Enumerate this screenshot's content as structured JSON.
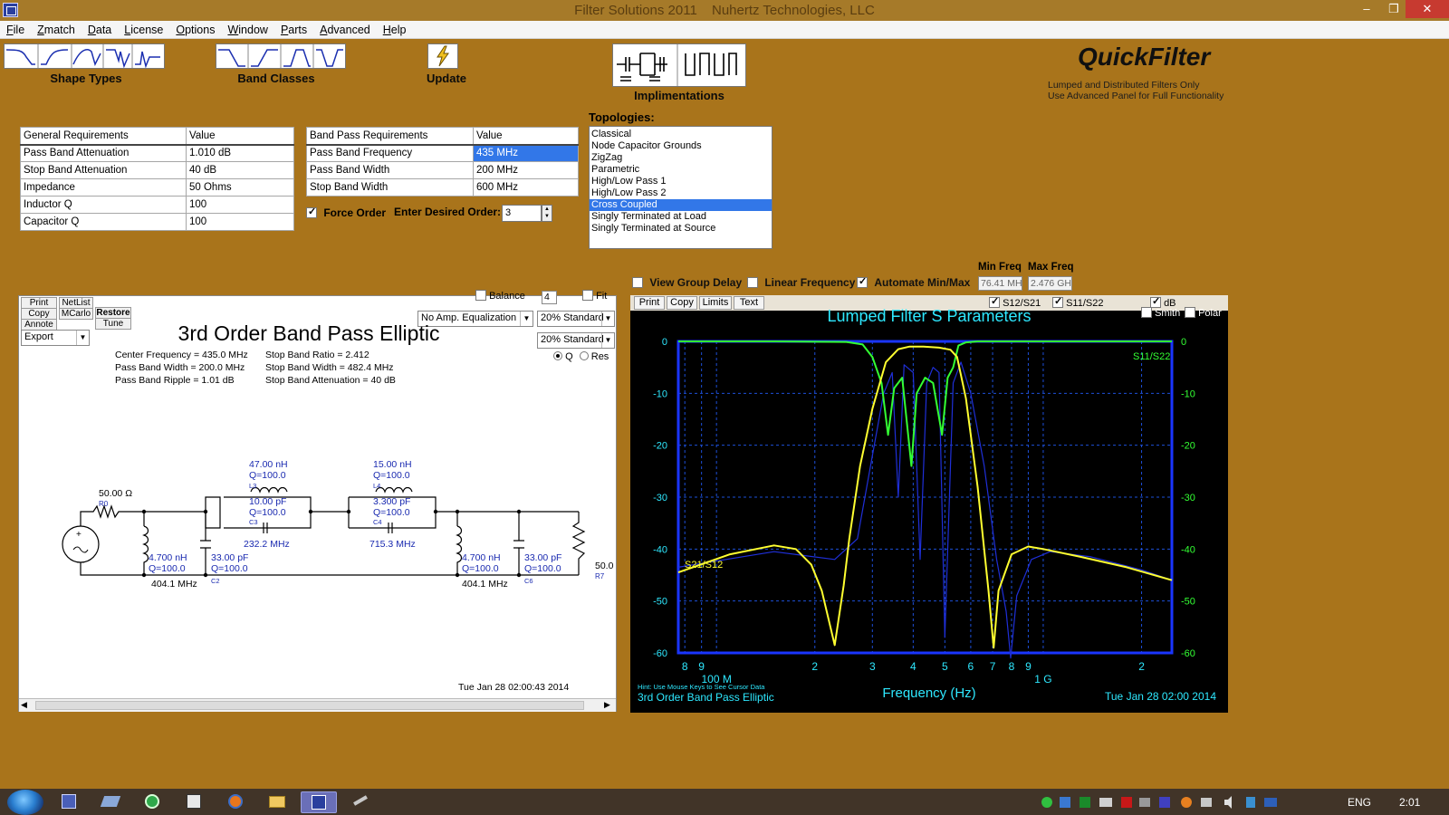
{
  "window": {
    "title_app": "Filter Solutions 2011",
    "title_company": "Nuhertz Technologies, LLC",
    "controls": {
      "minimize": "–",
      "restore": "❐",
      "close": "✕"
    }
  },
  "menu": [
    {
      "key": "F",
      "rest": "ile"
    },
    {
      "key": "Z",
      "rest": "match"
    },
    {
      "key": "D",
      "rest": "ata"
    },
    {
      "key": "L",
      "rest": "icense"
    },
    {
      "key": "O",
      "rest": "ptions"
    },
    {
      "key": "W",
      "rest": "indow"
    },
    {
      "key": "P",
      "rest": "arts"
    },
    {
      "key": "A",
      "rest": "dvanced"
    },
    {
      "key": "H",
      "rest": "elp"
    }
  ],
  "toolbar": {
    "shape_types": "Shape Types",
    "band_classes": "Band Classes",
    "update": "Update",
    "implementations": "Implimentations",
    "update_icon": "lightning-icon"
  },
  "quickfilter": {
    "title": "QuickFilter",
    "note1": "Lumped and Distributed Filters Only",
    "note2": "Use Advanced Panel for Full Functionality"
  },
  "general_requirements": {
    "col1": "General Requirements",
    "col2": "Value",
    "rows": [
      {
        "name": "Pass Band Attenuation",
        "value": "1.010 dB"
      },
      {
        "name": "Stop Band Attenuation",
        "value": "40 dB"
      },
      {
        "name": "Impedance",
        "value": "50 Ohms"
      },
      {
        "name": "Inductor Q",
        "value": "100"
      },
      {
        "name": "Capacitor Q",
        "value": "100"
      }
    ]
  },
  "bandpass_requirements": {
    "col1": "Band Pass Requirements",
    "col2": "Value",
    "rows": [
      {
        "name": "Pass Band Frequency",
        "value": "435 MHz"
      },
      {
        "name": "Pass Band Width",
        "value": "200 MHz"
      },
      {
        "name": "Stop Band Width",
        "value": "600 MHz"
      }
    ]
  },
  "order": {
    "force_order": "Force Order",
    "desired_label": "Enter Desired Order:",
    "value": "3"
  },
  "topologies": {
    "label": "Topologies:",
    "items": [
      "Classical",
      "Node Capacitor Grounds",
      "ZigZag",
      "Parametric",
      "High/Low Pass 1",
      "High/Low Pass 2",
      "Cross Coupled",
      "Singly Terminated at Load",
      "Singly Terminated at Source"
    ],
    "selected": 6
  },
  "schematic": {
    "buttons": {
      "print": "Print",
      "copy": "Copy",
      "annote": "Annote",
      "netlist": "NetList",
      "mcarlo": "MCarlo",
      "restore": "Restore",
      "tune": "Tune"
    },
    "export": "Export",
    "balance": "Balance",
    "balance_value": "4",
    "fit": "Fit",
    "equalization": "No Amp. Equalization",
    "standard1": "20% Standard",
    "standard2": "20% Standard",
    "q_label": "Q",
    "res_label": "Res",
    "title": "3rd Order Band Pass Elliptic",
    "info_left": [
      "Center Frequency = 435.0 MHz",
      "Pass Band Width = 200.0 MHz",
      "Pass Band Ripple = 1.01 dB"
    ],
    "info_right": [
      "Stop Band Ratio = 2.412",
      "Stop Band Width = 482.4 MHz",
      "Stop Band Attenuation = 40 dB"
    ],
    "source_r": "50.00 Ω",
    "r0": "R0",
    "l3_val": "47.00 nH",
    "l3_q": "Q=100.0",
    "l3": "L3",
    "c3_val": "10.00 pF",
    "c3_q": "Q=100.0",
    "c3": "C3",
    "f1": "232.2 MHz",
    "l4_val": "15.00 nH",
    "l4_q": "Q=100.0",
    "l4": "L4",
    "c4_val": "3.300 pF",
    "c4_q": "Q=100.0",
    "c4": "C4",
    "f2": "715.3 MHz",
    "l1_val": "4.700 nH",
    "l1_q": "Q=100.0",
    "f3": "404.1 MHz",
    "c2_val": "33.00 pF",
    "c2_q": "Q=100.0",
    "c2": "C2",
    "l5_val": "4.700 nH",
    "l5_q": "Q=100.0",
    "f4": "404.1 MHz",
    "c6_val": "33.00 pF",
    "c6_q": "Q=100.0",
    "c6": "C6",
    "load_r": "50.0",
    "r7": "R7",
    "timestamp": "Tue Jan 28 02:00:43 2014"
  },
  "chart_options": {
    "view_group_delay": "View Group Delay",
    "linear_frequency": "Linear Frequency",
    "automate": "Automate Min/Max",
    "min_freq_label": "Min Freq",
    "max_freq_label": "Max Freq",
    "min_freq": "76.41 MH",
    "max_freq": "2.476 GH",
    "print": "Print",
    "copy": "Copy",
    "limits": "Limits",
    "text": "Text",
    "s12s21": "S12/S21",
    "s11s22": "S11/S22",
    "db": "dB",
    "smith": "Smith",
    "polar": "Polar"
  },
  "chart_data": {
    "type": "line",
    "title": "Lumped Filter S Parameters",
    "xlabel": "Frequency (Hz)",
    "x_scale": "log",
    "xlim": [
      76410000.0,
      2476000000.0
    ],
    "ylim": [
      -60,
      0
    ],
    "yticks": [
      0,
      -10,
      -20,
      -30,
      -40,
      -50,
      -60
    ],
    "xticks": [
      {
        "v": 80000000.0,
        "label": "8"
      },
      {
        "v": 90000000.0,
        "label": "9"
      },
      {
        "v": 200000000.0,
        "label": "2"
      },
      {
        "v": 300000000.0,
        "label": "3"
      },
      {
        "v": 400000000.0,
        "label": "4"
      },
      {
        "v": 500000000.0,
        "label": "5"
      },
      {
        "v": 600000000.0,
        "label": "6"
      },
      {
        "v": 700000000.0,
        "label": "7"
      },
      {
        "v": 800000000.0,
        "label": "8"
      },
      {
        "v": 900000000.0,
        "label": "9"
      },
      {
        "v": 2000000000.0,
        "label": "2"
      }
    ],
    "decade_labels": [
      {
        "v": 100000000.0,
        "label": "100 M"
      },
      {
        "v": 1000000000.0,
        "label": "1 G"
      }
    ],
    "grid": true,
    "series": [
      {
        "name": "S21/S12",
        "color": "#ffff30",
        "x": [
          76410000.0,
          110000000.0,
          150000000.0,
          175000000.0,
          195000000.0,
          210000000.0,
          230000000.0,
          245000000.0,
          255000000.0,
          275000000.0,
          300000000.0,
          330000000.0,
          360000000.0,
          390000000.0,
          430000000.0,
          480000000.0,
          520000000.0,
          545000000.0,
          580000000.0,
          630000000.0,
          680000000.0,
          705000000.0,
          730000000.0,
          800000000.0,
          900000000.0,
          1000000000.0,
          1300000000.0,
          1800000000.0,
          2476000000.0
        ],
        "y": [
          -44.5,
          -41,
          -39.3,
          -40,
          -43,
          -48,
          -58.5,
          -47,
          -38,
          -24,
          -13,
          -4,
          -1.5,
          -1,
          -1,
          -1.2,
          -1.6,
          -3,
          -11,
          -28,
          -48,
          -59,
          -48,
          -41,
          -39.5,
          -40,
          -41.5,
          -43.5,
          -46
        ]
      },
      {
        "name": "S11/S22",
        "color": "#33ff33",
        "x": [
          76410000.0,
          150000000.0,
          250000000.0,
          280000000.0,
          300000000.0,
          320000000.0,
          335000000.0,
          350000000.0,
          370000000.0,
          395000000.0,
          410000000.0,
          435000000.0,
          460000000.0,
          490000000.0,
          510000000.0,
          530000000.0,
          550000000.0,
          580000000.0,
          630000000.0,
          1000000000.0,
          2476000000.0
        ],
        "y": [
          0,
          0,
          -0.1,
          -0.6,
          -3,
          -8,
          -18,
          -9,
          -7,
          -24,
          -10,
          -7,
          -8,
          -18,
          -7,
          -5,
          -0.8,
          -0.2,
          0,
          0,
          0
        ]
      },
      {
        "name": "",
        "color": "#1f2fd8",
        "x": [
          76410000.0,
          150000000.0,
          230000000.0,
          270000000.0,
          300000000.0,
          325000000.0,
          345000000.0,
          360000000.0,
          375000000.0,
          400000000.0,
          420000000.0,
          440000000.0,
          460000000.0,
          480000000.0,
          500000000.0,
          530000000.0,
          560000000.0,
          600000000.0,
          660000000.0,
          720000000.0,
          770000000.0,
          795000000.0,
          830000000.0,
          920000000.0,
          1050000000.0,
          1400000000.0,
          2000000000.0,
          2476000000.0
        ],
        "y": [
          -43.5,
          -40.5,
          -42,
          -38,
          -22,
          -10,
          -6,
          -30,
          -4.5,
          -6,
          -42,
          -8,
          -5,
          -6,
          -57,
          -8,
          -4,
          -10,
          -24,
          -42,
          -52,
          -61,
          -49,
          -42,
          -40.5,
          -41.5,
          -44,
          -46
        ]
      }
    ],
    "series_labels": {
      "s21": "S21/S12",
      "s11": "S11/S22"
    },
    "footer_hint": "Hint: Use Mouse Keys to See Cursor Data",
    "footer_title": "3rd Order Band Pass Elliptic",
    "footer_date": "Tue Jan 28 02:00 2014"
  },
  "taskbar": {
    "lang": "ENG",
    "time": "2:01"
  }
}
